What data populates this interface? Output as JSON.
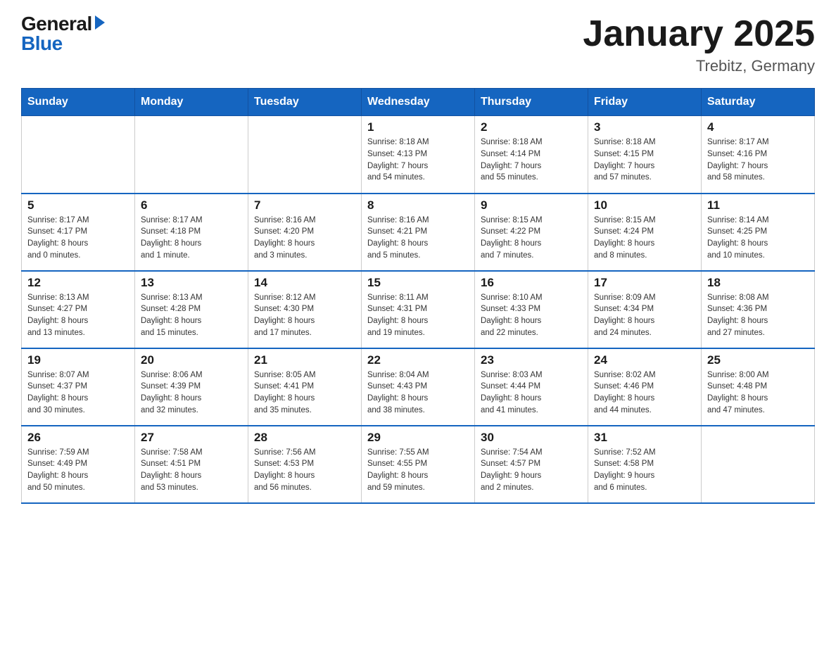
{
  "header": {
    "logo_general": "General",
    "logo_blue": "Blue",
    "title": "January 2025",
    "subtitle": "Trebitz, Germany"
  },
  "days_of_week": [
    "Sunday",
    "Monday",
    "Tuesday",
    "Wednesday",
    "Thursday",
    "Friday",
    "Saturday"
  ],
  "weeks": [
    [
      {
        "day": "",
        "info": ""
      },
      {
        "day": "",
        "info": ""
      },
      {
        "day": "",
        "info": ""
      },
      {
        "day": "1",
        "info": "Sunrise: 8:18 AM\nSunset: 4:13 PM\nDaylight: 7 hours\nand 54 minutes."
      },
      {
        "day": "2",
        "info": "Sunrise: 8:18 AM\nSunset: 4:14 PM\nDaylight: 7 hours\nand 55 minutes."
      },
      {
        "day": "3",
        "info": "Sunrise: 8:18 AM\nSunset: 4:15 PM\nDaylight: 7 hours\nand 57 minutes."
      },
      {
        "day": "4",
        "info": "Sunrise: 8:17 AM\nSunset: 4:16 PM\nDaylight: 7 hours\nand 58 minutes."
      }
    ],
    [
      {
        "day": "5",
        "info": "Sunrise: 8:17 AM\nSunset: 4:17 PM\nDaylight: 8 hours\nand 0 minutes."
      },
      {
        "day": "6",
        "info": "Sunrise: 8:17 AM\nSunset: 4:18 PM\nDaylight: 8 hours\nand 1 minute."
      },
      {
        "day": "7",
        "info": "Sunrise: 8:16 AM\nSunset: 4:20 PM\nDaylight: 8 hours\nand 3 minutes."
      },
      {
        "day": "8",
        "info": "Sunrise: 8:16 AM\nSunset: 4:21 PM\nDaylight: 8 hours\nand 5 minutes."
      },
      {
        "day": "9",
        "info": "Sunrise: 8:15 AM\nSunset: 4:22 PM\nDaylight: 8 hours\nand 7 minutes."
      },
      {
        "day": "10",
        "info": "Sunrise: 8:15 AM\nSunset: 4:24 PM\nDaylight: 8 hours\nand 8 minutes."
      },
      {
        "day": "11",
        "info": "Sunrise: 8:14 AM\nSunset: 4:25 PM\nDaylight: 8 hours\nand 10 minutes."
      }
    ],
    [
      {
        "day": "12",
        "info": "Sunrise: 8:13 AM\nSunset: 4:27 PM\nDaylight: 8 hours\nand 13 minutes."
      },
      {
        "day": "13",
        "info": "Sunrise: 8:13 AM\nSunset: 4:28 PM\nDaylight: 8 hours\nand 15 minutes."
      },
      {
        "day": "14",
        "info": "Sunrise: 8:12 AM\nSunset: 4:30 PM\nDaylight: 8 hours\nand 17 minutes."
      },
      {
        "day": "15",
        "info": "Sunrise: 8:11 AM\nSunset: 4:31 PM\nDaylight: 8 hours\nand 19 minutes."
      },
      {
        "day": "16",
        "info": "Sunrise: 8:10 AM\nSunset: 4:33 PM\nDaylight: 8 hours\nand 22 minutes."
      },
      {
        "day": "17",
        "info": "Sunrise: 8:09 AM\nSunset: 4:34 PM\nDaylight: 8 hours\nand 24 minutes."
      },
      {
        "day": "18",
        "info": "Sunrise: 8:08 AM\nSunset: 4:36 PM\nDaylight: 8 hours\nand 27 minutes."
      }
    ],
    [
      {
        "day": "19",
        "info": "Sunrise: 8:07 AM\nSunset: 4:37 PM\nDaylight: 8 hours\nand 30 minutes."
      },
      {
        "day": "20",
        "info": "Sunrise: 8:06 AM\nSunset: 4:39 PM\nDaylight: 8 hours\nand 32 minutes."
      },
      {
        "day": "21",
        "info": "Sunrise: 8:05 AM\nSunset: 4:41 PM\nDaylight: 8 hours\nand 35 minutes."
      },
      {
        "day": "22",
        "info": "Sunrise: 8:04 AM\nSunset: 4:43 PM\nDaylight: 8 hours\nand 38 minutes."
      },
      {
        "day": "23",
        "info": "Sunrise: 8:03 AM\nSunset: 4:44 PM\nDaylight: 8 hours\nand 41 minutes."
      },
      {
        "day": "24",
        "info": "Sunrise: 8:02 AM\nSunset: 4:46 PM\nDaylight: 8 hours\nand 44 minutes."
      },
      {
        "day": "25",
        "info": "Sunrise: 8:00 AM\nSunset: 4:48 PM\nDaylight: 8 hours\nand 47 minutes."
      }
    ],
    [
      {
        "day": "26",
        "info": "Sunrise: 7:59 AM\nSunset: 4:49 PM\nDaylight: 8 hours\nand 50 minutes."
      },
      {
        "day": "27",
        "info": "Sunrise: 7:58 AM\nSunset: 4:51 PM\nDaylight: 8 hours\nand 53 minutes."
      },
      {
        "day": "28",
        "info": "Sunrise: 7:56 AM\nSunset: 4:53 PM\nDaylight: 8 hours\nand 56 minutes."
      },
      {
        "day": "29",
        "info": "Sunrise: 7:55 AM\nSunset: 4:55 PM\nDaylight: 8 hours\nand 59 minutes."
      },
      {
        "day": "30",
        "info": "Sunrise: 7:54 AM\nSunset: 4:57 PM\nDaylight: 9 hours\nand 2 minutes."
      },
      {
        "day": "31",
        "info": "Sunrise: 7:52 AM\nSunset: 4:58 PM\nDaylight: 9 hours\nand 6 minutes."
      },
      {
        "day": "",
        "info": ""
      }
    ]
  ]
}
